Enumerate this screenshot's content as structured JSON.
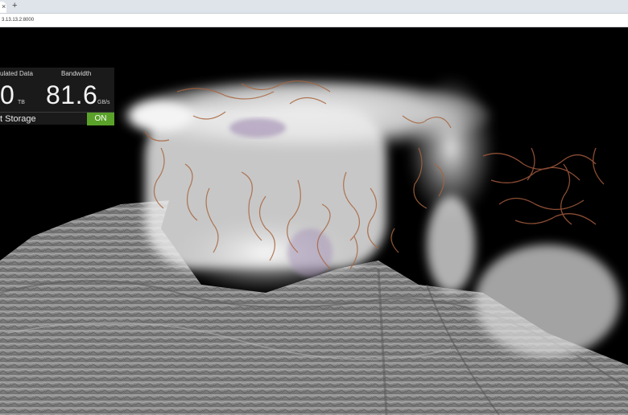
{
  "browser": {
    "tab_close": "×",
    "new_tab": "+",
    "url": "3.13.13.2:8000"
  },
  "stats": {
    "simulated_label": "ulated Data",
    "simulated_value": "0",
    "simulated_unit": "TB",
    "bandwidth_label": "Bandwidth",
    "bandwidth_value": "81.6",
    "bandwidth_unit": "GB/s",
    "storage_label": "t Storage",
    "storage_toggle": "ON"
  },
  "colors": {
    "toggle_on": "#5aa22a",
    "panel_bg": "#1c1c1c",
    "terrain": "#8a8a8a",
    "cloud": "#f0f0f0",
    "streamline": "#b0704a"
  },
  "icons": {
    "tab_close": "close-icon",
    "new_tab": "plus-icon"
  }
}
